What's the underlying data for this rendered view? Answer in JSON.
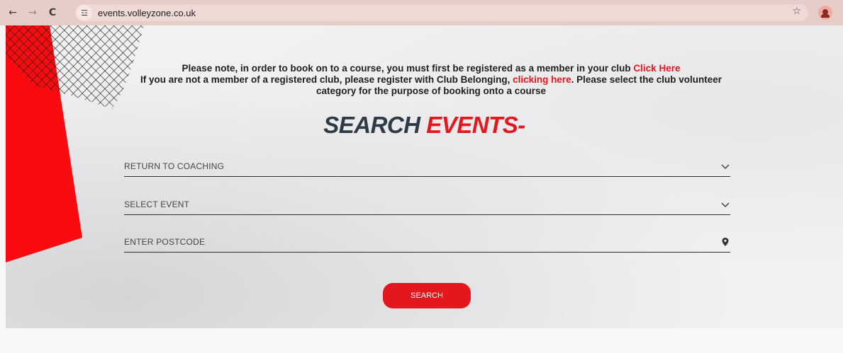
{
  "browser": {
    "url": "events.volleyzone.co.uk",
    "back_icon": "←",
    "forward_icon": "→",
    "reload_icon": "C",
    "site_settings_icon": "☲",
    "bookmark_icon": "☆"
  },
  "notice": {
    "line1_text": "Please note, in order to book on to a course, you must first be registered as a member in your club ",
    "line1_link": "Click Here",
    "line2_text": "If you are not a member of a registered club, please register with Club Belonging, ",
    "line2_link": "clicking here",
    "line2_rest": ". Please select the club volunteer category for the purpose of booking onto a course"
  },
  "title": {
    "dark": "SEARCH",
    "red": "EVENTS-"
  },
  "form": {
    "category_value": "RETURN TO COACHING",
    "event_placeholder": "SELECT EVENT",
    "postcode_placeholder": "ENTER POSTCODE",
    "search_label": "SEARCH"
  },
  "colors": {
    "accent_red": "#e4171e",
    "title_dark": "#2e3a46",
    "chrome_bar": "#e7cdc7"
  }
}
